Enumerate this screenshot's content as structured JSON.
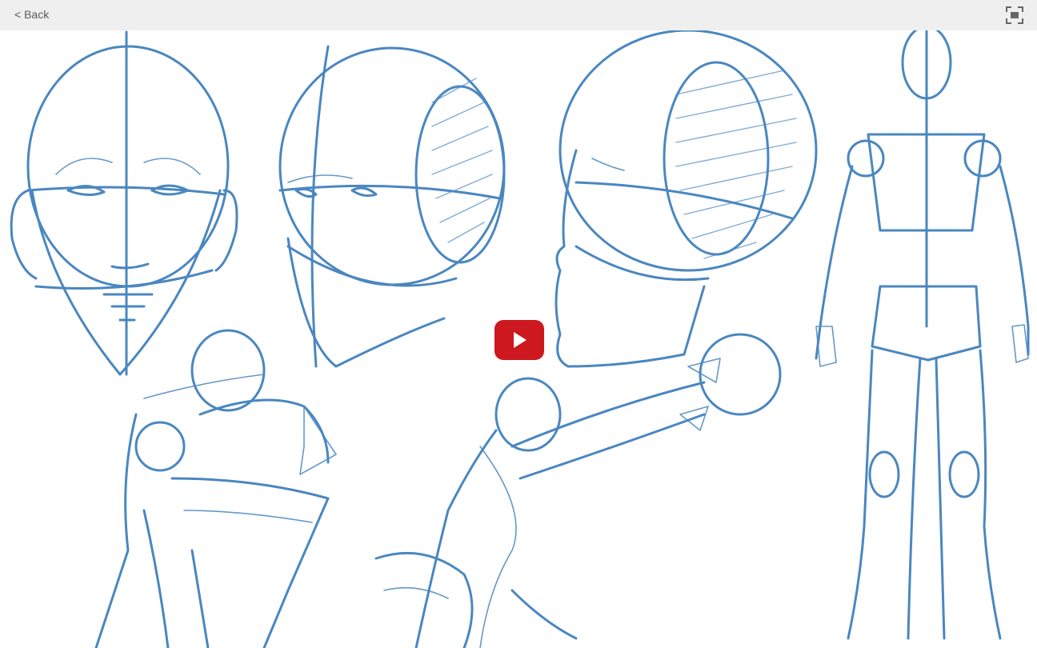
{
  "topbar": {
    "back_label": "< Back",
    "fullscreen_icon": "fullscreen-icon"
  },
  "video": {
    "play_icon": "youtube-play-icon",
    "accent_color": "#cc181e",
    "sketch_color": "#4a87c0"
  }
}
